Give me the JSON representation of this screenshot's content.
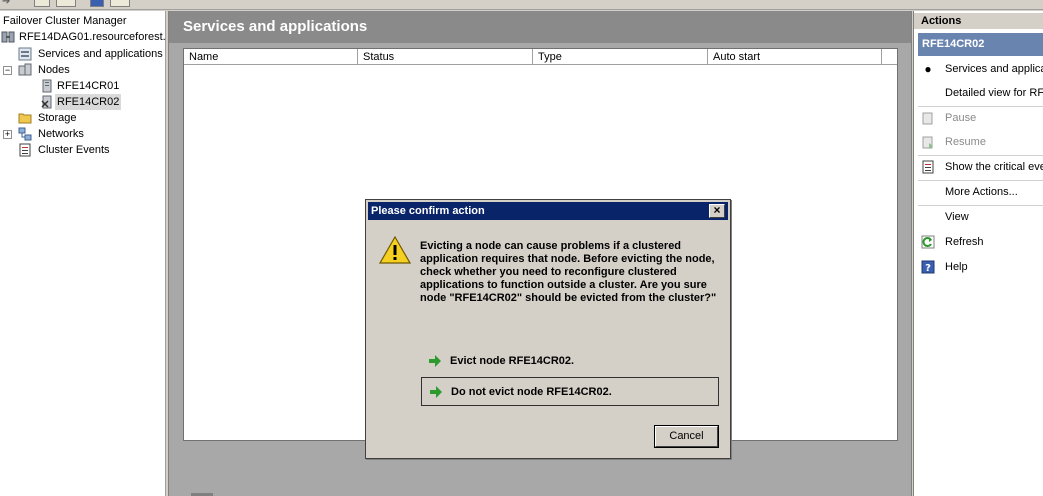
{
  "tree": {
    "root": "Failover Cluster Manager",
    "cluster": "RFE14DAG01.resourceforest.l",
    "services": "Services and applications",
    "nodes": "Nodes",
    "node1": "RFE14CR01",
    "node2": "RFE14CR02",
    "storage": "Storage",
    "networks": "Networks",
    "events": "Cluster Events"
  },
  "center": {
    "title": "Services and applications",
    "columns": [
      "Name",
      "Status",
      "Type",
      "Auto start"
    ]
  },
  "actions": {
    "title": "Actions",
    "subtitle": "RFE14CR02",
    "items": [
      {
        "label": "Services and applicatio",
        "icon": "bullet-icon",
        "disabled": false
      },
      {
        "label": "Detailed view for RF",
        "icon": "",
        "disabled": false
      },
      {
        "label": "Pause",
        "icon": "pause-icon",
        "disabled": true
      },
      {
        "label": "Resume",
        "icon": "resume-icon",
        "disabled": true
      },
      {
        "label": "Show the critical eve",
        "icon": "event-log-icon",
        "disabled": false
      },
      {
        "label": "More Actions...",
        "icon": "",
        "disabled": false
      },
      {
        "label": "View",
        "icon": "",
        "disabled": false
      },
      {
        "label": "Refresh",
        "icon": "refresh-icon",
        "disabled": false
      },
      {
        "label": "Help",
        "icon": "help-icon",
        "disabled": false
      }
    ]
  },
  "dialog": {
    "title": "Please confirm action",
    "close": "×",
    "message": "Evicting a node can cause problems if a clustered application requires that node.  Before evicting the node, check whether you need to reconfigure clustered applications to function outside a cluster. Are you sure node \"RFE14CR02\" should be evicted from the cluster?\"",
    "evict": "Evict node RFE14CR02.",
    "no_evict": "Do not evict node RFE14CR02.",
    "cancel": "Cancel"
  },
  "colors": {
    "dialog_title": "#0a246a",
    "actions_header": "#6a84b0",
    "center_title": "#8a8a8a",
    "arrow_green": "#2e9a2e"
  }
}
